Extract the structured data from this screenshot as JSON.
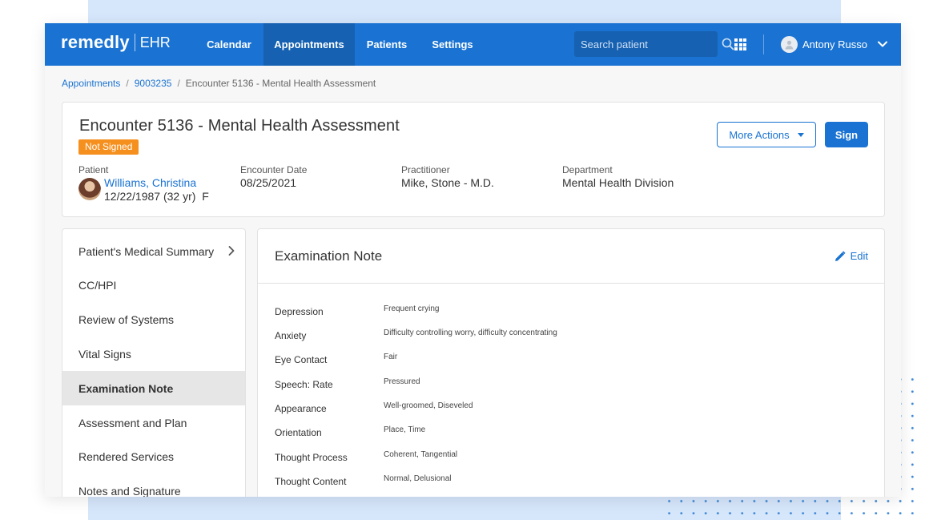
{
  "brand": {
    "name": "remedly",
    "product": "EHR"
  },
  "nav": {
    "items": [
      {
        "label": "Calendar"
      },
      {
        "label": "Appointments"
      },
      {
        "label": "Patients"
      },
      {
        "label": "Settings"
      }
    ],
    "active": "Appointments",
    "search_placeholder": "Search patient",
    "user_name": "Antony Russo"
  },
  "breadcrumb": [
    "Appointments",
    "9003235",
    "Encounter 5136 - Mental Health Assessment"
  ],
  "encounter": {
    "title": "Encounter 5136 - Mental Health Assessment",
    "status": "Not Signed",
    "patient_label": "Patient",
    "patient_name": "Williams, Christina",
    "patient_dob": "12/22/1987 (32 yr)",
    "patient_sex": "F",
    "date_label": "Encounter Date",
    "date": "08/25/2021",
    "practitioner_label": "Practitioner",
    "practitioner": "Mike, Stone - M.D.",
    "department_label": "Department",
    "department": "Mental Health Division",
    "more_actions_label": "More Actions",
    "sign_label": "Sign"
  },
  "side_nav": {
    "items": [
      {
        "label": "Patient's Medical Summary"
      },
      {
        "label": "CC/HPI"
      },
      {
        "label": "Review of Systems"
      },
      {
        "label": "Vital Signs"
      },
      {
        "label": "Examination Note"
      },
      {
        "label": "Assessment and Plan"
      },
      {
        "label": "Rendered Services"
      },
      {
        "label": "Notes and Signature"
      }
    ],
    "active": "Examination Note"
  },
  "exam_note": {
    "title": "Examination Note",
    "edit_label": "Edit",
    "rows": [
      {
        "label": "Depression",
        "value": "Frequent crying"
      },
      {
        "label": "Anxiety",
        "value": "Difficulty controlling worry, difficulty concentrating"
      },
      {
        "label": "Eye Contact",
        "value": "Fair"
      },
      {
        "label": "Speech: Rate",
        "value": "Pressured"
      },
      {
        "label": "Appearance",
        "value": "Well-groomed, Diseveled"
      },
      {
        "label": "Orientation",
        "value": "Place, Time"
      },
      {
        "label": "Thought Process",
        "value": "Coherent, Tangential"
      },
      {
        "label": "Thought Content",
        "value": "Normal, Delusional"
      }
    ]
  },
  "colors": {
    "primary": "#1a73d2",
    "nav_active": "#1661b1",
    "status_badge": "#f5901f",
    "backdrop": "#d6e6fb"
  },
  "icons": [
    "search-icon",
    "apps-grid-icon",
    "user-avatar-icon",
    "chevron-down-icon",
    "chevron-right-icon",
    "pencil-icon"
  ]
}
